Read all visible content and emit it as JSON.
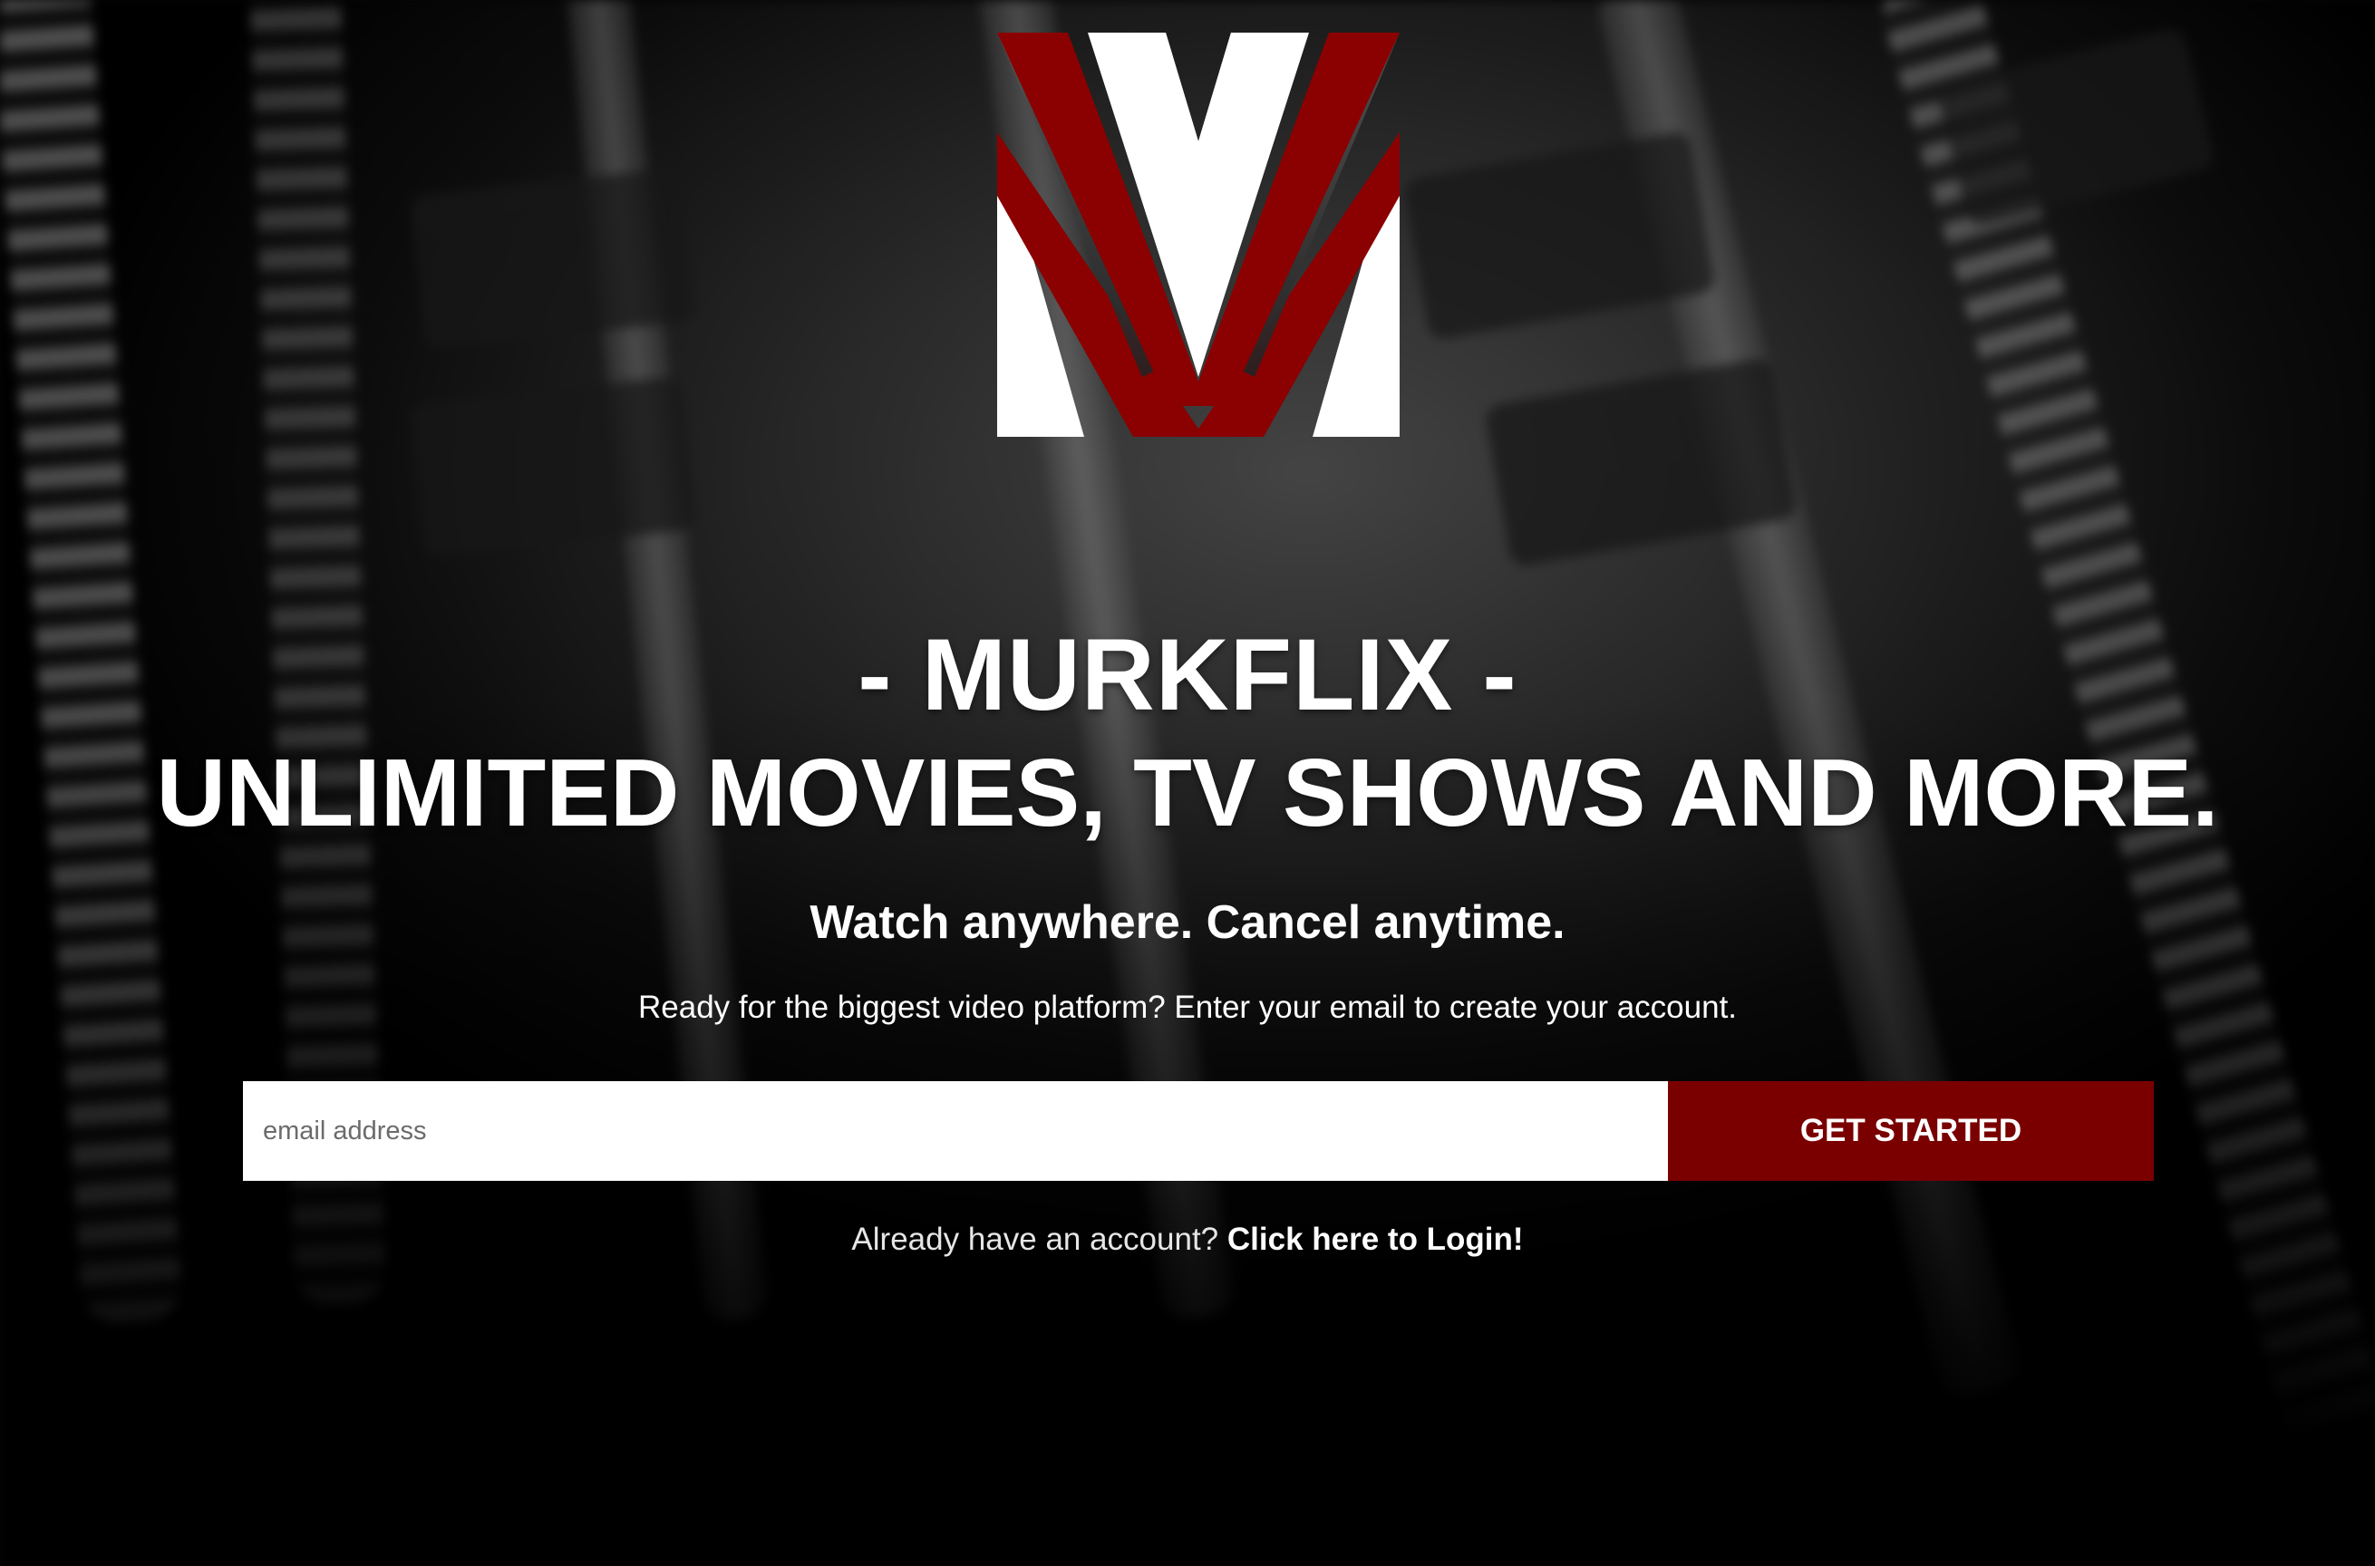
{
  "brand": {
    "logo_letter": "V",
    "logo_colors": {
      "red": "#8b0000",
      "white": "#ffffff",
      "shadow": "#3a3a3a"
    },
    "name_line": "- MURKFLIX -",
    "tagline": "UNLIMITED MOVIES, TV SHOWS AND MORE."
  },
  "hero": {
    "subtitle": "Watch anywhere. Cancel anytime.",
    "prompt": "Ready for the biggest video platform? Enter your email to create your account."
  },
  "signup": {
    "email_placeholder": "email address",
    "email_value": "",
    "button_label": "GET STARTED",
    "button_color": "#7a0000"
  },
  "login": {
    "prefix": "Already have an account?",
    "link_label": "Click here to Login!"
  }
}
